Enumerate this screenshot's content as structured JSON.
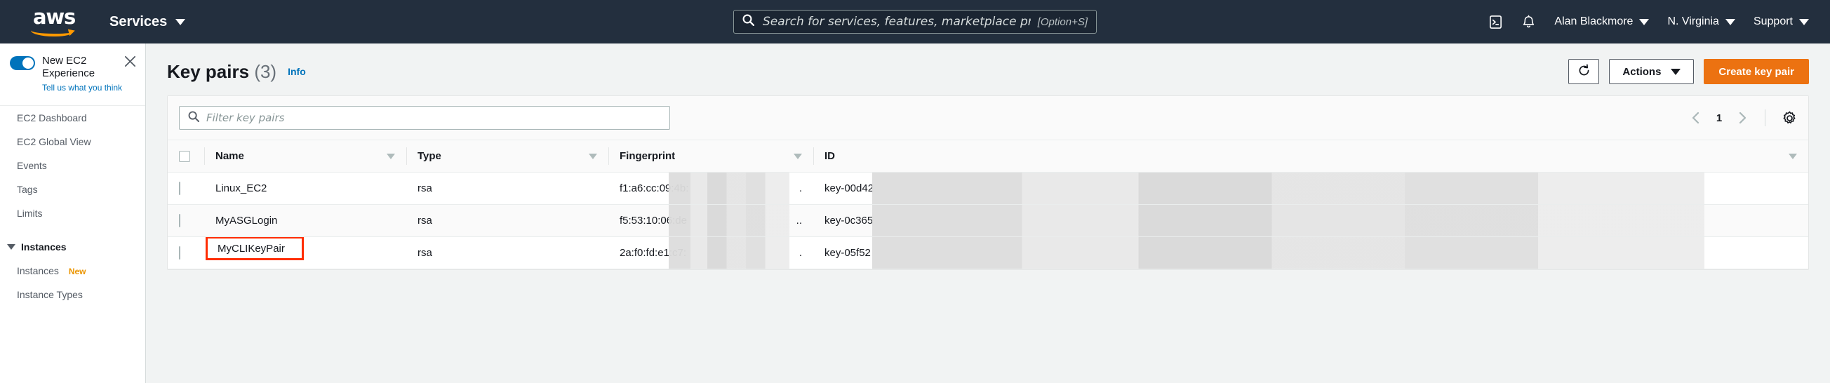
{
  "topnav": {
    "logo_text": "aws",
    "logo_name": "aws-logo",
    "services_label": "Services",
    "search": {
      "placeholder": "Search for services, features, marketplace products, and docs",
      "shortcut": "[Option+S]",
      "icon": "search-icon"
    },
    "cloudshell_icon": "cloudshell-icon",
    "notifications_icon": "bell-icon",
    "account_label": "Alan Blackmore",
    "region_label": "N. Virginia",
    "support_label": "Support"
  },
  "sidebar": {
    "experience": {
      "title": "New EC2 Experience",
      "feedback_link": "Tell us what you think",
      "toggle_on": true,
      "close_icon": "close-icon"
    },
    "items": [
      {
        "label": "EC2 Dashboard",
        "type": "link"
      },
      {
        "label": "EC2 Global View",
        "type": "link"
      },
      {
        "label": "Events",
        "type": "link"
      },
      {
        "label": "Tags",
        "type": "link"
      },
      {
        "label": "Limits",
        "type": "link"
      }
    ],
    "groups": [
      {
        "label": "Instances",
        "expanded": true,
        "children": [
          {
            "label": "Instances",
            "badge": "New"
          },
          {
            "label": "Instance Types",
            "badge": ""
          }
        ]
      }
    ]
  },
  "page": {
    "title": "Key pairs",
    "count": "(3)",
    "info_label": "Info",
    "refresh_icon": "refresh-icon",
    "actions_label": "Actions",
    "create_label": "Create key pair"
  },
  "toolbar": {
    "filter_placeholder": "Filter key pairs",
    "filter_value": "",
    "filter_icon": "search-icon",
    "prev_icon": "chevron-left-icon",
    "next_icon": "chevron-right-icon",
    "page_number": "1",
    "settings_icon": "gear-icon"
  },
  "table": {
    "columns": [
      {
        "label": "",
        "key": "check"
      },
      {
        "label": "Name",
        "key": "name"
      },
      {
        "label": "Type",
        "key": "type"
      },
      {
        "label": "Fingerprint",
        "key": "fingerprint"
      },
      {
        "label": "ID",
        "key": "id"
      }
    ],
    "rows": [
      {
        "name": "Linux_EC2",
        "type": "rsa",
        "fingerprint": "f1:a6:cc:09:4b:",
        "fingerprint_tail": ".",
        "id": "key-00d42",
        "highlighted": false
      },
      {
        "name": "MyASGLogin",
        "type": "rsa",
        "fingerprint": "f5:53:10:06:de",
        "fingerprint_tail": "..",
        "id": "key-0c365",
        "highlighted": false
      },
      {
        "name": "MyCLIKeyPair",
        "type": "rsa",
        "fingerprint": "2a:f0:fd:e1:c7:",
        "fingerprint_tail": ".",
        "id": "key-05f52",
        "highlighted": true
      }
    ]
  },
  "colors": {
    "nav_bg": "#232f3e",
    "accent_orange": "#ec7211",
    "link_blue": "#0073bb",
    "badge_orange": "#eb9500",
    "highlight_red": "#ff2d00"
  }
}
